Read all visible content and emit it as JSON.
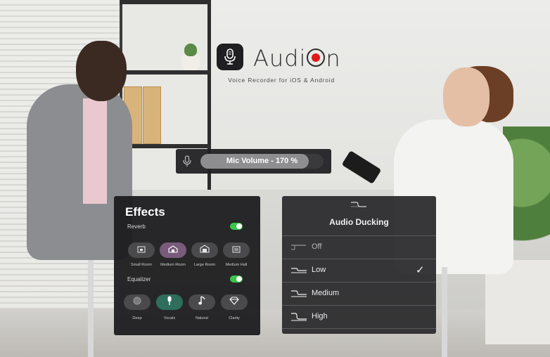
{
  "brand": {
    "name_part1": "Audi",
    "name_part2": "n",
    "tagline": "Voice Recorder for iOS & Android",
    "accent_color": "#e01a1a",
    "icon": "microphone-icon"
  },
  "mic_volume": {
    "label": "Mic Volume - 170 %",
    "level_percent": 170,
    "fill_fraction": 0.88,
    "icon": "microphone-icon"
  },
  "effects": {
    "title": "Effects",
    "reverb": {
      "label": "Reverb",
      "enabled": true,
      "selected": "Medium Room",
      "options": [
        {
          "label": "Small Room",
          "icon": "small-room-icon"
        },
        {
          "label": "Medium Room",
          "icon": "medium-room-icon"
        },
        {
          "label": "Large Room",
          "icon": "large-room-icon"
        },
        {
          "label": "Medium Hall",
          "icon": "medium-hall-icon"
        }
      ]
    },
    "equalizer": {
      "label": "Equalizer",
      "enabled": true,
      "selected": "Vocals",
      "options": [
        {
          "label": "Deep",
          "icon": "deep-icon"
        },
        {
          "label": "Vocals",
          "icon": "vocals-mic-icon"
        },
        {
          "label": "Natural",
          "icon": "music-note-icon"
        },
        {
          "label": "Clarity",
          "icon": "diamond-icon"
        }
      ]
    },
    "toggle_color": "#39c74a"
  },
  "audio_ducking": {
    "title": "Audio Ducking",
    "icon": "ducking-curve-icon",
    "selected": "Low",
    "options": [
      {
        "label": "Off",
        "icon": "ducking-off-icon"
      },
      {
        "label": "Low",
        "icon": "ducking-low-icon",
        "checked": true
      },
      {
        "label": "Medium",
        "icon": "ducking-medium-icon"
      },
      {
        "label": "High",
        "icon": "ducking-high-icon"
      }
    ],
    "check_glyph": "✓"
  }
}
